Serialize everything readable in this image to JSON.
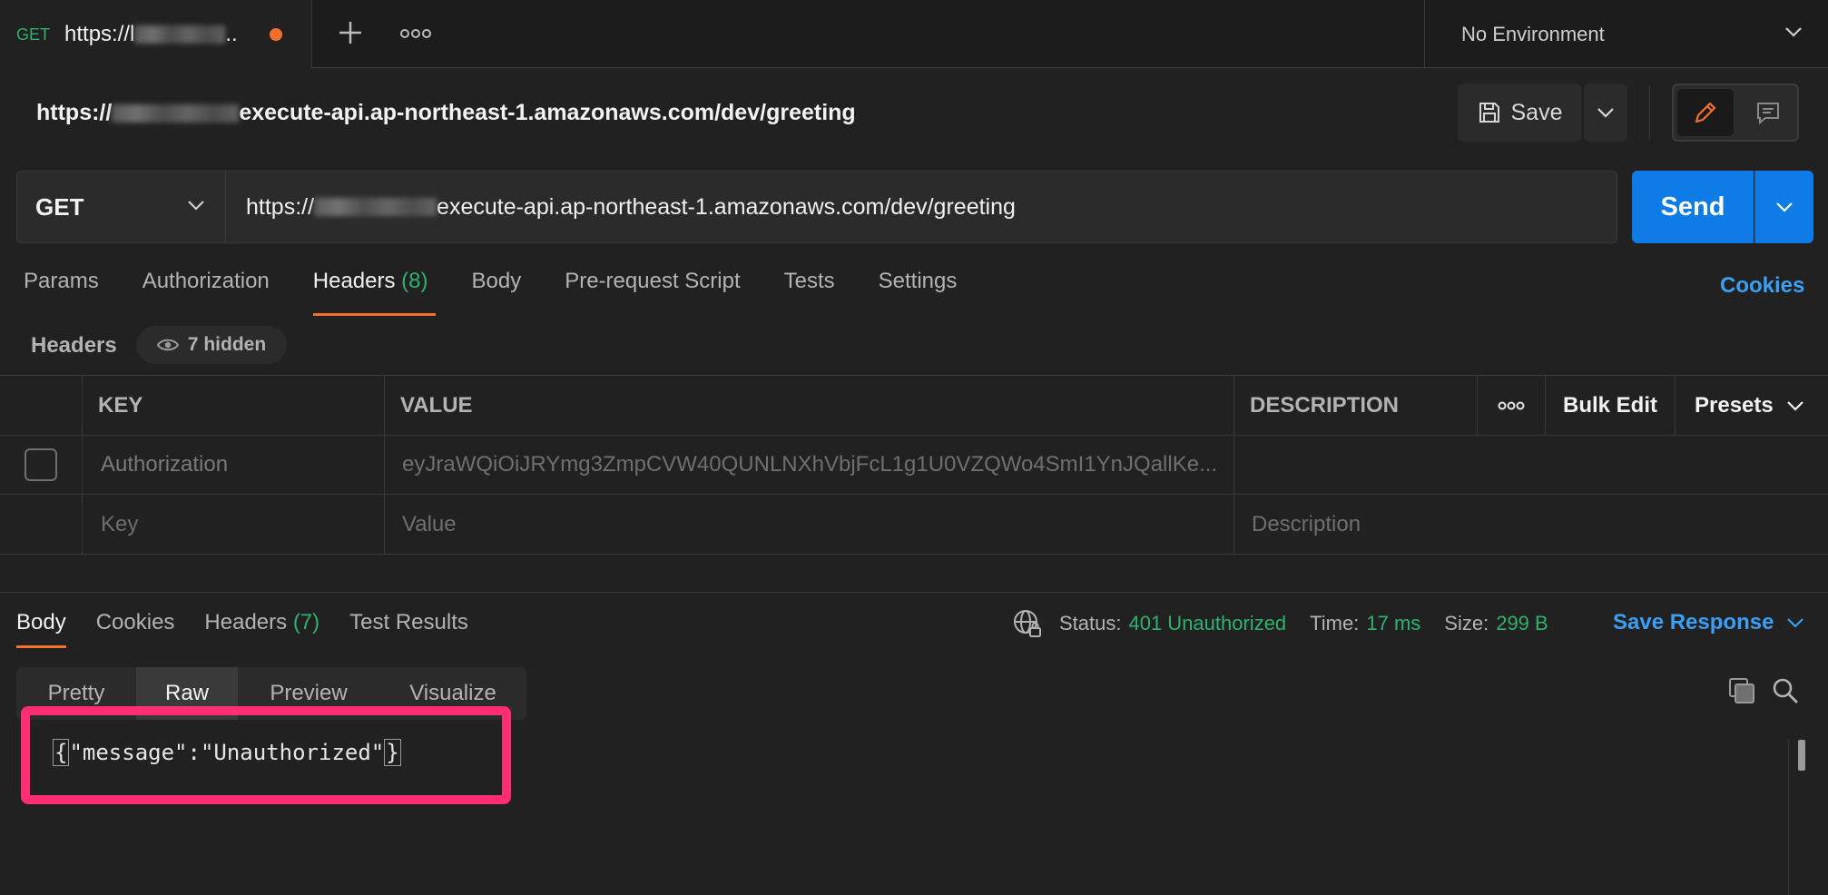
{
  "tab": {
    "method": "GET",
    "title": "https://l",
    "title_suffix": ".."
  },
  "environment": {
    "label": "No Environment"
  },
  "request": {
    "title_prefix": "https://",
    "title_suffix": "execute-api.ap-northeast-1.amazonaws.com/dev/greeting",
    "save_label": "Save",
    "method": "GET",
    "url_prefix": "https://",
    "url_suffix": "execute-api.ap-northeast-1.amazonaws.com/dev/greeting",
    "send_label": "Send"
  },
  "request_tabs": [
    {
      "label": "Params",
      "count": ""
    },
    {
      "label": "Authorization",
      "count": ""
    },
    {
      "label": "Headers",
      "count": "(8)"
    },
    {
      "label": "Body",
      "count": ""
    },
    {
      "label": "Pre-request Script",
      "count": ""
    },
    {
      "label": "Tests",
      "count": ""
    },
    {
      "label": "Settings",
      "count": ""
    }
  ],
  "cookies_link": "Cookies",
  "headers_section": {
    "label": "Headers",
    "hidden": "7 hidden"
  },
  "table": {
    "columns": {
      "key": "KEY",
      "value": "VALUE",
      "description": "DESCRIPTION",
      "bulk_edit": "Bulk Edit",
      "presets": "Presets"
    },
    "rows": [
      {
        "key": "Authorization",
        "value": "eyJraWQiOiJRYmg3ZmpCVW40QUNLNXhVbjFcL1g1U0VZQWo4SmI1YnJQallKe...",
        "description": ""
      }
    ],
    "placeholder": {
      "key": "Key",
      "value": "Value",
      "description": "Description"
    }
  },
  "response": {
    "tabs": [
      {
        "label": "Body",
        "count": ""
      },
      {
        "label": "Cookies",
        "count": ""
      },
      {
        "label": "Headers",
        "count": "(7)"
      },
      {
        "label": "Test Results",
        "count": ""
      }
    ],
    "status_label": "Status:",
    "status_value": "401 Unauthorized",
    "time_label": "Time:",
    "time_value": "17 ms",
    "size_label": "Size:",
    "size_value": "299 B",
    "save_response": "Save Response",
    "view_tabs": [
      "Pretty",
      "Raw",
      "Preview",
      "Visualize"
    ],
    "body_open": "{",
    "body_text": "\"message\":\"Unauthorized\"",
    "body_close": "}"
  },
  "colors": {
    "accent_orange": "#f56f2f",
    "send_blue": "#0f7be6",
    "success_green": "#2fb26b",
    "link_blue": "#3a9ff5",
    "annotation_pink": "#ff2e73"
  }
}
